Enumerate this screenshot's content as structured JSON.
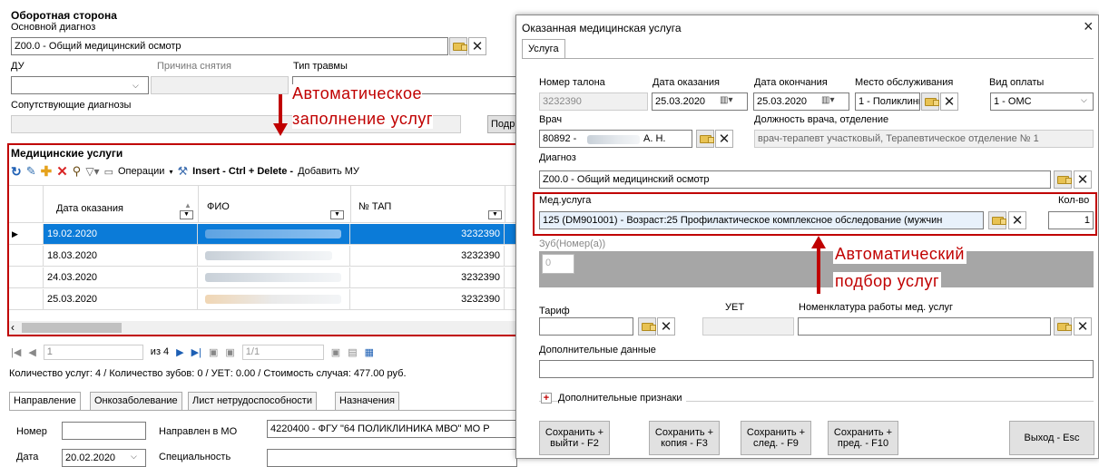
{
  "left": {
    "section_title": "Оборотная сторона",
    "main_diag_label": "Основной диагноз",
    "main_diag_value": "Z00.0 - Общий медицинский осмотр",
    "du_label": "ДУ",
    "reason_label": "Причина снятия",
    "trauma_label": "Тип травмы",
    "related_label": "Сопутствующие диагнозы",
    "related_btn": "Подр",
    "services_title": "Медицинские услуги",
    "toolbar": {
      "operations": "Операции",
      "insert": "Insert - Ctrl + Delete -",
      "add_mu": "Добавить МУ"
    },
    "columns": [
      "Дата оказания",
      "ФИО",
      "№ ТАП"
    ],
    "rows": [
      {
        "date": "19.02.2020",
        "tap": "3232390"
      },
      {
        "date": "18.03.2020",
        "tap": "3232390"
      },
      {
        "date": "24.03.2020",
        "tap": "3232390"
      },
      {
        "date": "25.03.2020",
        "tap": "3232390"
      }
    ],
    "pager": {
      "page": "1",
      "of": "из 4",
      "pages": "1/1"
    },
    "summary": "Количество услуг: 4 / Количество зубов: 0 / УЕТ: 0.00 / Стоимость случая: 477.00 руб.",
    "tabs": [
      "Направление",
      "Онкозаболевание",
      "Лист нетрудоспособности",
      "Назначения"
    ],
    "number_label": "Номер",
    "directed_label": "Направлен в МО",
    "directed_value": "4220400 - ФГУ \"64 ПОЛИКЛИНИКА МВО\" МО Р",
    "date_label": "Дата",
    "date_value": "20.02.2020",
    "specialty_label": "Специальность"
  },
  "annotations": {
    "auto_fill_line1": "Автоматическое",
    "auto_fill_line2": "заполнение услуг",
    "auto_pick_line1": "Автоматический",
    "auto_pick_line2": "подбор услуг"
  },
  "dialog": {
    "title": "Оказанная медицинская услуга",
    "close": "×",
    "tab": "Услуга",
    "ticket_label": "Номер талона",
    "ticket_value": "3232390",
    "date_label": "Дата оказания",
    "date_value": "25.03.2020",
    "end_label": "Дата окончания",
    "end_value": "25.03.2020",
    "place_label": "Место обслуживания",
    "place_value": "1 - Поликлиник",
    "pay_label": "Вид оплаты",
    "pay_value": "1 - ОМС",
    "doctor_label": "Врач",
    "doctor_code": "80892 -",
    "doctor_initials": "А. Н.",
    "position_label": "Должность врача, отделение",
    "position_value": "врач-терапевт участковый, Терапевтическое отделение № 1",
    "diag_label": "Диагноз",
    "diag_value": "Z00.0 - Общий медицинский осмотр",
    "service_label": "Мед.услуга",
    "service_value": "125 (DM901001) - Возраст:25 Профилактическое комплексное обследование (мужчин",
    "qty_label": "Кол-во",
    "qty_value": "1",
    "tooth_label": "Зуб(Номер(а))",
    "tooth_value": "0",
    "tariff_label": "Тариф",
    "uet_label": "УЕТ",
    "nomen_label": "Номенклатура работы мед. услуг",
    "extra_label": "Дополнительные данные",
    "extra_signs": "Дополнительные признаки",
    "buttons": [
      "Сохранить +\nвыйти - F2",
      "Сохранить +\nкопия - F3",
      "Сохранить +\nслед. - F9",
      "Сохранить +\nпред. - F10"
    ],
    "exit": "Выход - Esc"
  },
  "colors": {
    "accent_red": "#c00000",
    "selection_blue": "#0b7bd8"
  }
}
